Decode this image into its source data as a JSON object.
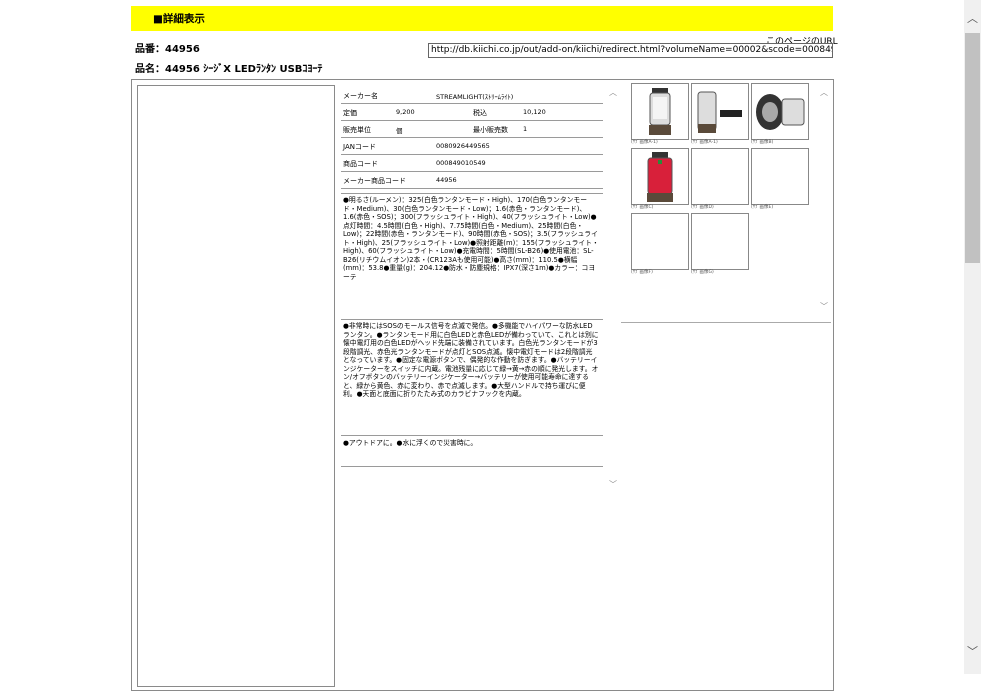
{
  "header": {
    "title": "■詳細表示"
  },
  "product": {
    "code_line": "品番：44956",
    "name_line": "品名：44956 ｼｰｼﾞX LEDﾗﾝﾀﾝ USBｺﾖｰﾃ"
  },
  "url": {
    "label": "このページのURL",
    "value": "http://db.kiichi.co.jp/out/add-on/kiichi/redirect.html?volumeName=00002&scode=000849010549"
  },
  "spec": {
    "maker_label": "メーカー名",
    "maker_value": "STREAMLIGHT(ｽﾄﾘｰﾑﾗｲﾄ)",
    "list_price_label": "定価",
    "list_price_value": "9,200",
    "tax_label": "税込",
    "tax_value": "10,120",
    "unit_label": "販売単位",
    "unit_value": "個",
    "min_label": "最小販売数",
    "min_value": "1",
    "jan_label": "JANコード",
    "jan_value": "0080926449565",
    "item_code_label": "商品コード",
    "item_code_value": "000849010549",
    "maker_code_label": "メーカー商品コード",
    "maker_code_value": "44956"
  },
  "specs_text": "●明るさ(ルーメン)：325(白色ランタンモード・High)、170(白色ランタンモード・Medium)、30(白色ランタンモード・Low)；1.6(赤色・ランタンモード)、1.6(赤色・SOS)；300(フラッシュライト・High)、40(フラッシュライト・Low)●点灯時間：4.5時間(白色・High)、7.75時間(白色・Medium)、25時間(白色・Low)；22時間(赤色・ランタンモード)、90時間(赤色・SOS)；3.5(フラッシュライト・High)、25(フラッシュライト・Low)●照射距離(m)：155(フラッシュライト・High)、60(フラッシュライト・Low)●充電時間：5時間(SL-B26)●使用電池：SL-B26(リチウムイオン)2本・(CR123Aも使用可能)●高さ(mm)：110.5●横幅(mm)：53.8●重量(g)：204.12●防水・防塵規格：IPX7(深さ1m)●カラー：コヨーテ",
  "features_text": "●非常時にはSOSのモールス信号を点滅で発信。●多機能でハイパワーな防水LEDランタン。●ランタンモード用に白色LEDと赤色LEDが備わっていて、これとは別に懐中電灯用の白色LEDがヘッド先端に装備されています。白色光ランタンモードが3段階調光、赤色光ランタンモードが点灯とSOS点滅。懐中電灯モードは2段階調光となっています。●固定な電源ボタンで、偶発的な作動を防ぎます。●バッテリーインジケーターをスイッチに内蔵。電池残量に応じて緑→黄→赤の順に発光します。オン/オフボタンのバッテリーインジケーター→バッテリーが使用可能寿命に達すると、緑から黄色、赤に変わり、赤で点滅します。●大型ハンドルで持ち運びに便利。●天面と底面に折りたたみ式のカラビナフックを内蔵。",
  "usage_text": "●アウトドアに。●水に浮くので災害時に。",
  "gallery": {
    "captions": [
      "(ｻﾌﾞ画像A-1)",
      "(ｻﾌﾞ画像A-1)",
      "(ｻﾌﾞ画像B)",
      "(ｻﾌﾞ画像C)",
      "(ｻﾌﾞ画像D)",
      "(ｻﾌﾞ画像E)",
      "(ｻﾌﾞ画像F)",
      "(ｻﾌﾞ画像G)"
    ]
  },
  "colors": {
    "header_bg": "#ffff00",
    "lantern_red": "#d8203a",
    "lantern_body": "#5a4a3a"
  }
}
